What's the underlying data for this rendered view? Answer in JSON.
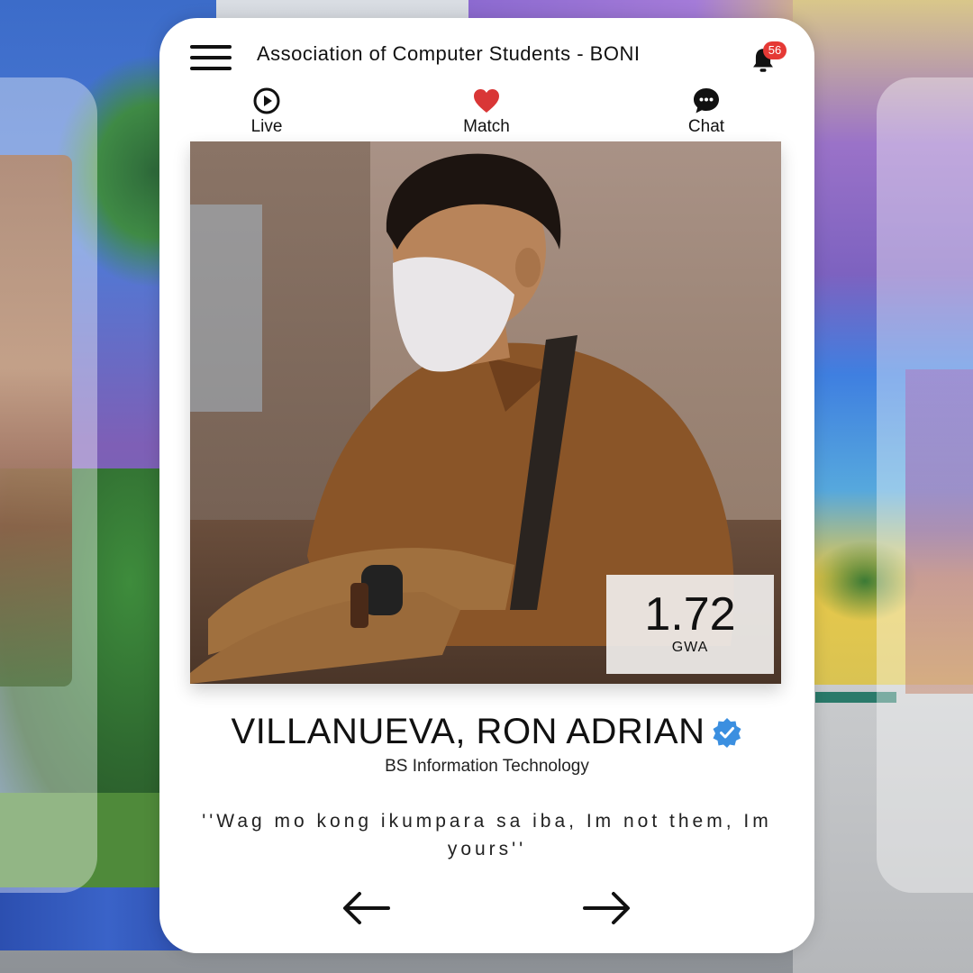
{
  "header": {
    "title": "Association of Computer Students - BONI",
    "notification_count": "56",
    "icons": {
      "menu": "hamburger-menu-icon",
      "notifications": "bell-icon"
    }
  },
  "nav": {
    "items": [
      {
        "label": "Live",
        "icon": "play-circle-icon"
      },
      {
        "label": "Match",
        "icon": "heart-icon",
        "color": "#d93636"
      },
      {
        "label": "Chat",
        "icon": "chat-bubble-icon"
      }
    ]
  },
  "profile": {
    "gwa_value": "1.72",
    "gwa_label": "GWA",
    "name": "VILLANUEVA, RON ADRIAN",
    "verified_icon": "verified-badge-icon",
    "verified_color": "#3b8fe0",
    "course": "BS Information Technology",
    "quote": "''Wag mo kong ikumpara sa iba, Im not them, Im yours''"
  },
  "pager": {
    "prev_icon": "arrow-left-icon",
    "next_icon": "arrow-right-icon"
  }
}
